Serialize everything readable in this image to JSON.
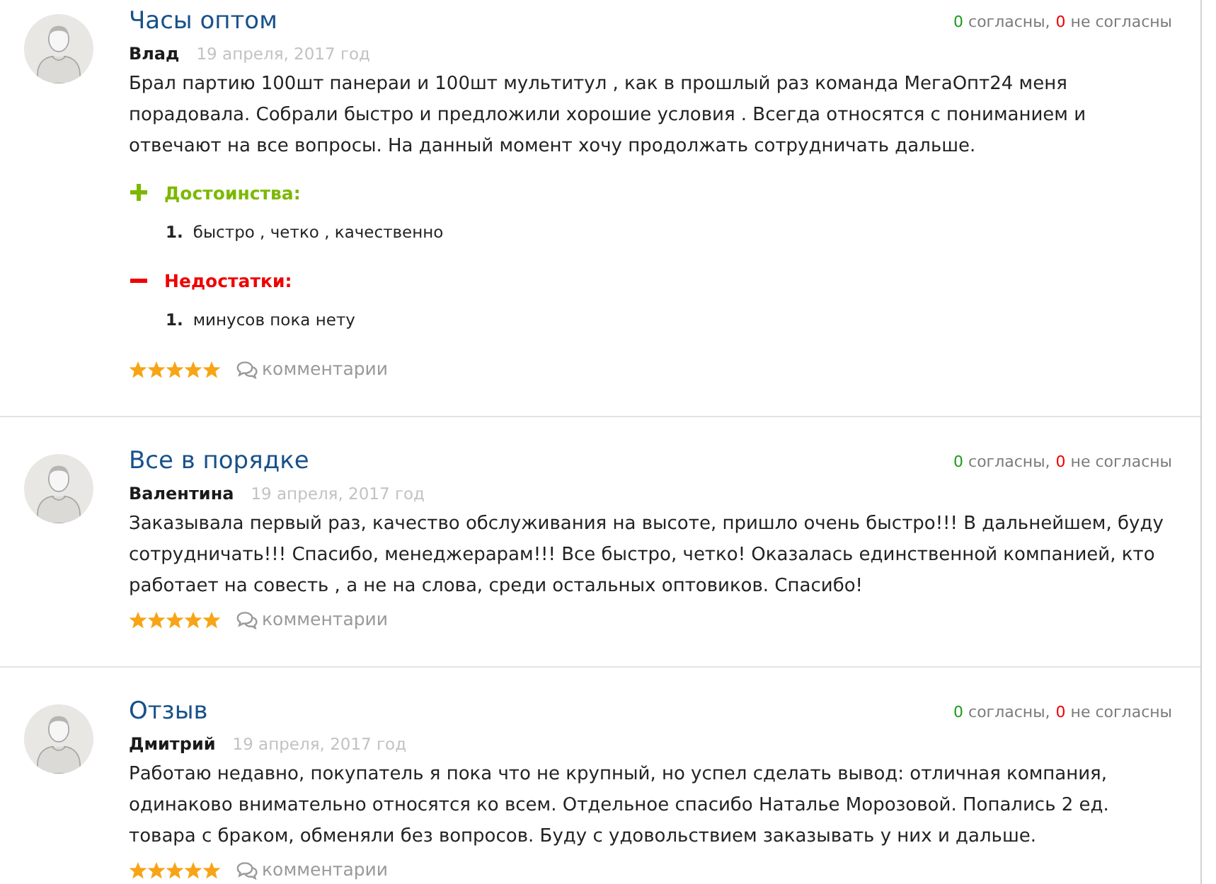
{
  "reviews": [
    {
      "title": "Часы оптом",
      "votes": {
        "agree_count": "0",
        "agree_label": "согласны,",
        "disagree_count": "0",
        "disagree_label": "не согласны"
      },
      "author": "Влад",
      "date": "19 апреля, 2017 год",
      "text": "Брал партию 100шт панераи и 100шт мультитул , как в прошлый раз команда МегаОпт24 меня порадовала. Собрали быстро и предложили хорошие условия . Всегда относятся с пониманием и отвечают на все вопросы. На данный момент хочу продолжать сотрудничать дальше.",
      "pros": {
        "heading": "Достоинства:",
        "items": [
          {
            "number": "1.",
            "text": "быстро , четко , качественно"
          }
        ]
      },
      "cons": {
        "heading": "Недостатки:",
        "items": [
          {
            "number": "1.",
            "text": "минусов пока нету"
          }
        ]
      },
      "stars": 5,
      "comments_link": "комментарии"
    },
    {
      "title": "Все в порядке",
      "votes": {
        "agree_count": "0",
        "agree_label": "согласны,",
        "disagree_count": "0",
        "disagree_label": "не согласны"
      },
      "author": "Валентина",
      "date": "19 апреля, 2017 год",
      "text": "Заказывала первый раз, качество обслуживания на высоте, пришло очень быстро!!! В дальнейшем, буду сотрудничать!!! Спасибо, менеджерарам!!! Все быстро, четко! Оказалась единственной компанией, кто работает на совесть , а не на слова, среди остальных оптовиков. Спасибо!",
      "stars": 5,
      "comments_link": "комментарии"
    },
    {
      "title": "Отзыв",
      "votes": {
        "agree_count": "0",
        "agree_label": "согласны,",
        "disagree_count": "0",
        "disagree_label": "не согласны"
      },
      "author": "Дмитрий",
      "date": "19 апреля, 2017 год",
      "text": "Работаю недавно, покупатель я пока что не крупный, но успел сделать вывод: отличная компания, одинаково внимательно относятся ко всем. Отдельное спасибо Наталье Морозовой. Попались 2 ед. товара с браком, обменяли без вопросов. Буду с удовольствием заказывать у них и дальше.",
      "stars": 5,
      "comments_link": "комментарии"
    }
  ]
}
